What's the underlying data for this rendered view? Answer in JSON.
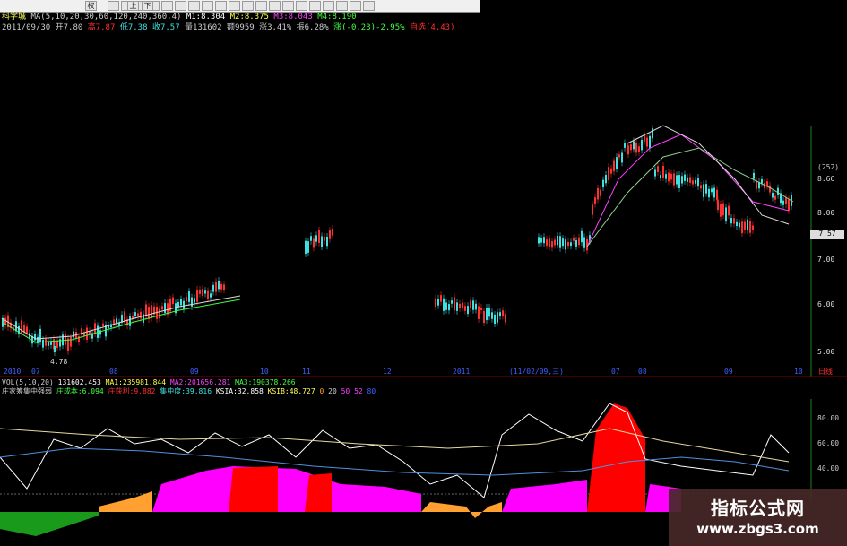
{
  "toolbar": {
    "icons": [
      "back-icon",
      "forward-icon",
      "refresh-icon",
      "chart-icon",
      "grid-icon",
      "list-icon",
      "flag-icon",
      "home-icon",
      "search-icon",
      "zoom-in-icon",
      "zoom-out-icon",
      "print-icon",
      "settings-icon",
      "help-icon",
      "up-arrow-icon",
      "down-arrow-icon",
      "left-arrow-icon",
      "right-arrow-icon",
      "window-icon",
      "close-icon"
    ],
    "quick_label_1": "权",
    "quick_label_2": "上",
    "quick_label_3": "下"
  },
  "header": {
    "stock_name": "科学城",
    "ma_params": "MA(5,10,20,30,60,120,240,360,4)",
    "m1": "M1:8.304",
    "m2": "M2:8.375",
    "m3": "M3:8.043",
    "m4": "M4:8.190",
    "date": "2011/09/30",
    "open": "开7.80",
    "high": "高7.87",
    "low": "低7.38",
    "close": "收7.57",
    "volume": "量131602",
    "amount": "额9959",
    "change_pct": "涨3.41%",
    "amplitude": "振6.28%",
    "change": "涨(-0.23)-2.95%",
    "self_select": "自选(4.43)"
  },
  "price_axis": {
    "labels": [
      "(252)",
      "8.66",
      "8.00",
      "7.00",
      "6.00",
      "5.00"
    ],
    "current_tag": "7.57"
  },
  "annotations": {
    "low_mark": "4.78"
  },
  "date_axis": {
    "labels": [
      "2010",
      "07",
      "08",
      "09",
      "10",
      "11",
      "12",
      "2011",
      "(11/02/09,三)",
      "07",
      "08",
      "09",
      "10"
    ],
    "period": "日线"
  },
  "vol_line": {
    "label": "VOL(5,10,20)",
    "value": "131602.453",
    "ma1": "MA1:235981.844",
    "ma2": "MA2:201656.281",
    "ma3": "MA3:190378.266"
  },
  "indicator_line": {
    "name": "庄家筹集中强弱",
    "cost": "庄成本:6.094",
    "profit": "庄获利:9.882",
    "concentration": "集中度:39.816",
    "ksia": "KSIA:32.858",
    "ksib": "KSIB:48.727",
    "v1": "0",
    "v2": "20",
    "v3": "50",
    "v4": "52",
    "v5": "80"
  },
  "indicator_axis": {
    "labels": [
      "80.00",
      "60.00",
      "40.00"
    ]
  },
  "watermark": {
    "title": "指标公式网",
    "url": "www.zbgs3.com"
  },
  "colors": {
    "up": "#ff3030",
    "down": "#40e0e0",
    "magenta": "#ff00ff",
    "red_fill": "#ff0000",
    "orange_fill": "#ffa030",
    "green_fill": "#1a9a1a",
    "white_line": "#ffffff",
    "yellow_line": "#e8d8a0",
    "blue_line": "#5090e0",
    "axis_green": "#208020"
  }
}
